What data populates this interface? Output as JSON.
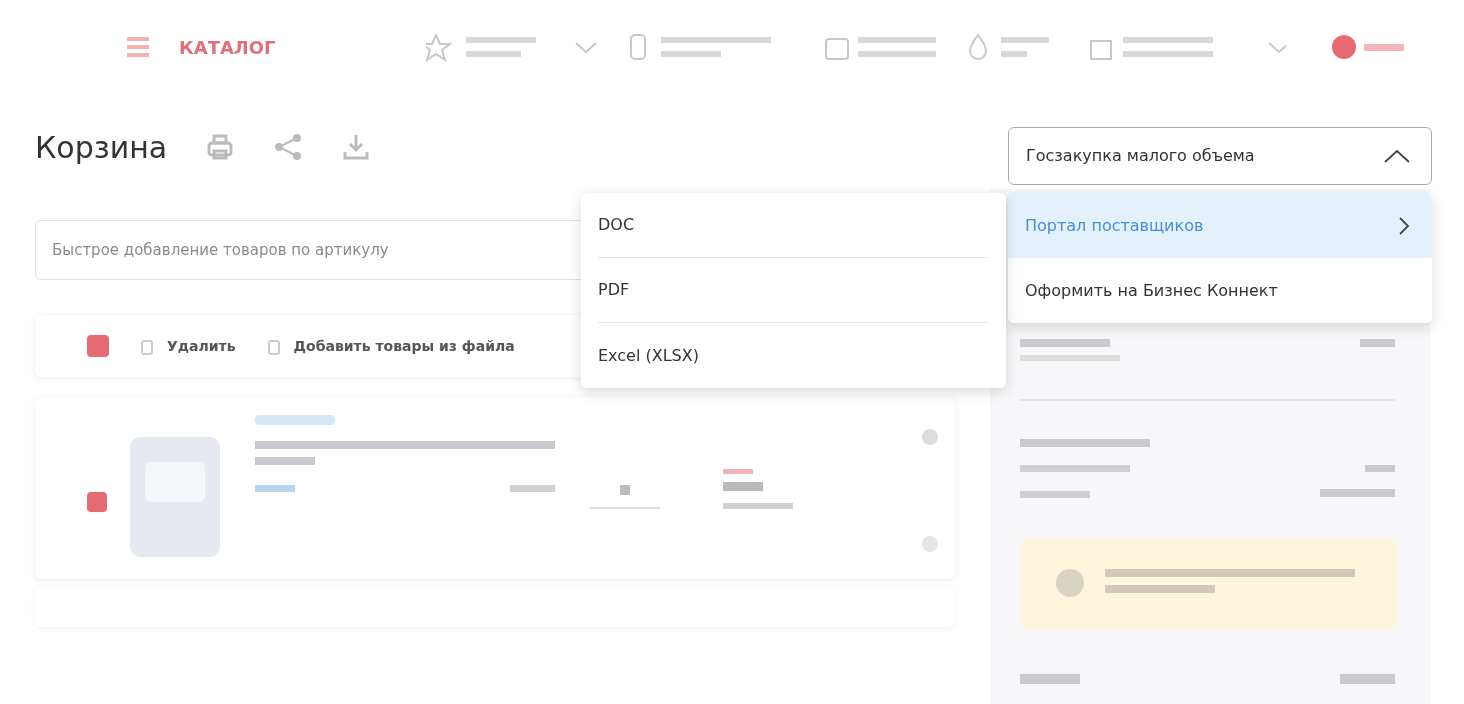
{
  "header": {
    "brand": "КАТАЛОГ"
  },
  "page": {
    "title": "Корзина",
    "search": {
      "placeholder": "Быстрое добавление товаров по артикулу"
    },
    "select_all": {
      "checked": true
    },
    "toolbar": [
      "Удалить",
      "Добавить товары из файла"
    ]
  },
  "export_menu": {
    "items": [
      {
        "label": "DOC"
      },
      {
        "label": "PDF"
      },
      {
        "label": "Excel (XLSX)"
      }
    ]
  },
  "procurement_select": {
    "value": "Госзакупка малого объема",
    "expanded": true,
    "items": [
      {
        "label": "Портал поставщиков",
        "selected": true,
        "has_submenu": true
      },
      {
        "label": "Оформить на Бизнес Коннект",
        "selected": false,
        "has_submenu": false
      }
    ]
  }
}
